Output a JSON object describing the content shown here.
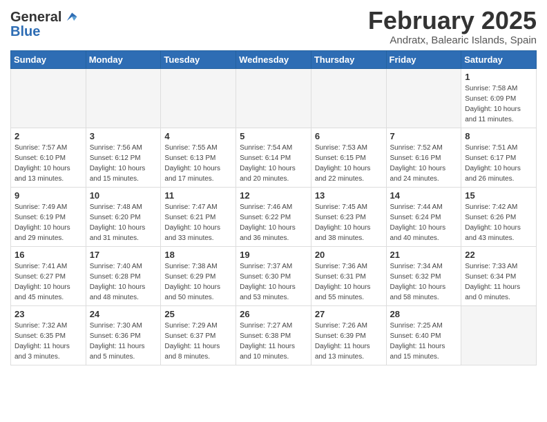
{
  "header": {
    "logo_general": "General",
    "logo_blue": "Blue",
    "month_title": "February 2025",
    "location": "Andratx, Balearic Islands, Spain"
  },
  "weekdays": [
    "Sunday",
    "Monday",
    "Tuesday",
    "Wednesday",
    "Thursday",
    "Friday",
    "Saturday"
  ],
  "weeks": [
    [
      {
        "day": "",
        "info": ""
      },
      {
        "day": "",
        "info": ""
      },
      {
        "day": "",
        "info": ""
      },
      {
        "day": "",
        "info": ""
      },
      {
        "day": "",
        "info": ""
      },
      {
        "day": "",
        "info": ""
      },
      {
        "day": "1",
        "info": "Sunrise: 7:58 AM\nSunset: 6:09 PM\nDaylight: 10 hours and 11 minutes."
      }
    ],
    [
      {
        "day": "2",
        "info": "Sunrise: 7:57 AM\nSunset: 6:10 PM\nDaylight: 10 hours and 13 minutes."
      },
      {
        "day": "3",
        "info": "Sunrise: 7:56 AM\nSunset: 6:12 PM\nDaylight: 10 hours and 15 minutes."
      },
      {
        "day": "4",
        "info": "Sunrise: 7:55 AM\nSunset: 6:13 PM\nDaylight: 10 hours and 17 minutes."
      },
      {
        "day": "5",
        "info": "Sunrise: 7:54 AM\nSunset: 6:14 PM\nDaylight: 10 hours and 20 minutes."
      },
      {
        "day": "6",
        "info": "Sunrise: 7:53 AM\nSunset: 6:15 PM\nDaylight: 10 hours and 22 minutes."
      },
      {
        "day": "7",
        "info": "Sunrise: 7:52 AM\nSunset: 6:16 PM\nDaylight: 10 hours and 24 minutes."
      },
      {
        "day": "8",
        "info": "Sunrise: 7:51 AM\nSunset: 6:17 PM\nDaylight: 10 hours and 26 minutes."
      }
    ],
    [
      {
        "day": "9",
        "info": "Sunrise: 7:49 AM\nSunset: 6:19 PM\nDaylight: 10 hours and 29 minutes."
      },
      {
        "day": "10",
        "info": "Sunrise: 7:48 AM\nSunset: 6:20 PM\nDaylight: 10 hours and 31 minutes."
      },
      {
        "day": "11",
        "info": "Sunrise: 7:47 AM\nSunset: 6:21 PM\nDaylight: 10 hours and 33 minutes."
      },
      {
        "day": "12",
        "info": "Sunrise: 7:46 AM\nSunset: 6:22 PM\nDaylight: 10 hours and 36 minutes."
      },
      {
        "day": "13",
        "info": "Sunrise: 7:45 AM\nSunset: 6:23 PM\nDaylight: 10 hours and 38 minutes."
      },
      {
        "day": "14",
        "info": "Sunrise: 7:44 AM\nSunset: 6:24 PM\nDaylight: 10 hours and 40 minutes."
      },
      {
        "day": "15",
        "info": "Sunrise: 7:42 AM\nSunset: 6:26 PM\nDaylight: 10 hours and 43 minutes."
      }
    ],
    [
      {
        "day": "16",
        "info": "Sunrise: 7:41 AM\nSunset: 6:27 PM\nDaylight: 10 hours and 45 minutes."
      },
      {
        "day": "17",
        "info": "Sunrise: 7:40 AM\nSunset: 6:28 PM\nDaylight: 10 hours and 48 minutes."
      },
      {
        "day": "18",
        "info": "Sunrise: 7:38 AM\nSunset: 6:29 PM\nDaylight: 10 hours and 50 minutes."
      },
      {
        "day": "19",
        "info": "Sunrise: 7:37 AM\nSunset: 6:30 PM\nDaylight: 10 hours and 53 minutes."
      },
      {
        "day": "20",
        "info": "Sunrise: 7:36 AM\nSunset: 6:31 PM\nDaylight: 10 hours and 55 minutes."
      },
      {
        "day": "21",
        "info": "Sunrise: 7:34 AM\nSunset: 6:32 PM\nDaylight: 10 hours and 58 minutes."
      },
      {
        "day": "22",
        "info": "Sunrise: 7:33 AM\nSunset: 6:34 PM\nDaylight: 11 hours and 0 minutes."
      }
    ],
    [
      {
        "day": "23",
        "info": "Sunrise: 7:32 AM\nSunset: 6:35 PM\nDaylight: 11 hours and 3 minutes."
      },
      {
        "day": "24",
        "info": "Sunrise: 7:30 AM\nSunset: 6:36 PM\nDaylight: 11 hours and 5 minutes."
      },
      {
        "day": "25",
        "info": "Sunrise: 7:29 AM\nSunset: 6:37 PM\nDaylight: 11 hours and 8 minutes."
      },
      {
        "day": "26",
        "info": "Sunrise: 7:27 AM\nSunset: 6:38 PM\nDaylight: 11 hours and 10 minutes."
      },
      {
        "day": "27",
        "info": "Sunrise: 7:26 AM\nSunset: 6:39 PM\nDaylight: 11 hours and 13 minutes."
      },
      {
        "day": "28",
        "info": "Sunrise: 7:25 AM\nSunset: 6:40 PM\nDaylight: 11 hours and 15 minutes."
      },
      {
        "day": "",
        "info": ""
      }
    ]
  ]
}
